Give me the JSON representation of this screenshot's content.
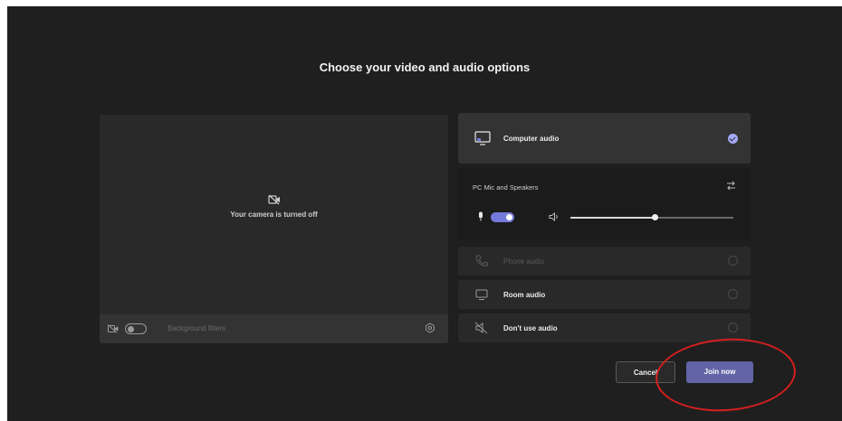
{
  "page": {
    "title": "Choose your video and audio options"
  },
  "preview": {
    "camera_message": "Your camera is turned off",
    "background_filters_label": "Background filters",
    "camera_toggle_on": false
  },
  "audio_options": {
    "computer_audio": {
      "label": "Computer audio",
      "selected": true
    },
    "device": {
      "name": "PC Mic and Speakers",
      "mic_on": true,
      "volume_fraction": 0.52
    },
    "phone_audio": {
      "label": "Phone audio",
      "enabled": false
    },
    "room_audio": {
      "label": "Room audio"
    },
    "no_audio": {
      "label": "Don't use audio"
    }
  },
  "buttons": {
    "cancel_label": "Cancel",
    "join_label": "Join now"
  },
  "colors": {
    "background": "#1f1f1f",
    "accent": "#6264a7",
    "toggle_on": "#7479dc",
    "annotation": "#d41f1f"
  },
  "icons": {
    "camera_off": "camera-off-icon",
    "settings": "gear-icon",
    "computer": "monitor-icon",
    "phone": "phone-icon",
    "room": "room-icon",
    "no_audio": "speaker-off-icon",
    "swap": "swap-icon",
    "mic": "mic-icon",
    "speaker": "speaker-icon"
  }
}
